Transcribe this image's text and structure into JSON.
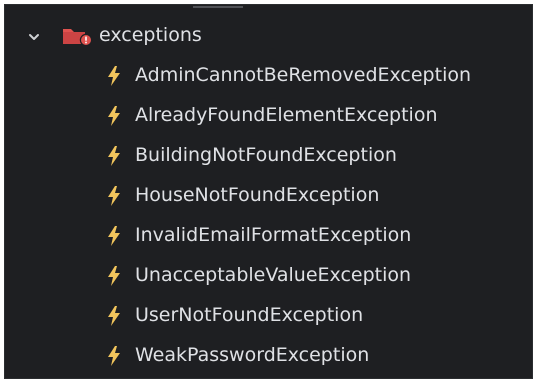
{
  "tree": {
    "folder": {
      "label": "exceptions",
      "expanded": true,
      "icon": "folder-error-icon",
      "color": "#e0524f"
    },
    "items": [
      {
        "label": "AdminCannotBeRemovedException",
        "icon": "lightning-bolt-icon"
      },
      {
        "label": "AlreadyFoundElementException",
        "icon": "lightning-bolt-icon"
      },
      {
        "label": "BuildingNotFoundException",
        "icon": "lightning-bolt-icon"
      },
      {
        "label": "HouseNotFoundException",
        "icon": "lightning-bolt-icon"
      },
      {
        "label": "InvalidEmailFormatException",
        "icon": "lightning-bolt-icon"
      },
      {
        "label": "UnacceptableValueException",
        "icon": "lightning-bolt-icon"
      },
      {
        "label": "UserNotFoundException",
        "icon": "lightning-bolt-icon"
      },
      {
        "label": "WeakPasswordException",
        "icon": "lightning-bolt-icon"
      }
    ]
  },
  "colors": {
    "background": "#1e1f22",
    "text": "#dfe1e5",
    "bolt": "#f2c55c",
    "folder": "#e0524f"
  }
}
